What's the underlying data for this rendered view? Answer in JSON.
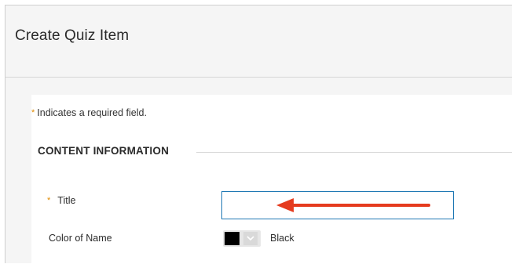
{
  "header": {
    "title": "Create Quiz Item"
  },
  "form": {
    "required_note": "Indicates a required field.",
    "required_marker": "*",
    "section_title": "CONTENT INFORMATION",
    "fields": {
      "title": {
        "label": "Title",
        "required": true,
        "value": "",
        "placeholder": ""
      },
      "color_of_name": {
        "label": "Color of Name",
        "selected_value": "Black",
        "swatch_color": "#000000"
      }
    }
  },
  "colors": {
    "accent_focus_border": "#1f78b4",
    "required_star": "#e08a00",
    "annotation_arrow": "#e53b1e",
    "background": "#f5f5f5"
  },
  "icons": {
    "required": "asterisk-icon",
    "dropdown": "chevron-down-icon",
    "annotation": "arrow-left-icon"
  }
}
